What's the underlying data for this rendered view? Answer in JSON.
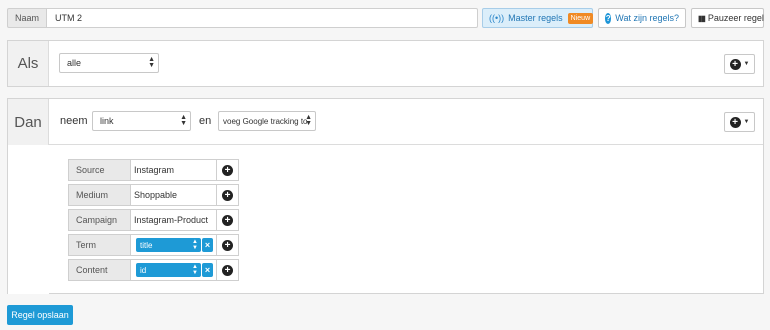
{
  "header": {
    "name_label": "Naam",
    "name_value": "UTM 2",
    "master_label": "Master regels",
    "master_badge": "Nieuw",
    "help_label": "Wat zijn regels?",
    "pause_label": "Pauzeer regel"
  },
  "als": {
    "label": "Als",
    "condition_select": "alle"
  },
  "dan": {
    "label": "Dan",
    "neem_word": "neem",
    "field_select": "link",
    "en_word": "en",
    "action_select": "voeg Google tracking to"
  },
  "params": [
    {
      "label": "Source",
      "value": "Instagram"
    },
    {
      "label": "Medium",
      "value": "Shoppable"
    },
    {
      "label": "Campaign",
      "value": "Instagram-Product"
    },
    {
      "label": "Term",
      "tag": "title"
    },
    {
      "label": "Content",
      "tag": "id"
    }
  ],
  "footer": {
    "save_label": "Regel opslaan"
  },
  "colors": {
    "accent": "#1e9ad6",
    "badge": "#f08a24"
  },
  "icons": {
    "master": "broadcast-icon",
    "help": "question-icon",
    "pause": "pause-icon",
    "add": "plus-circle-icon"
  }
}
